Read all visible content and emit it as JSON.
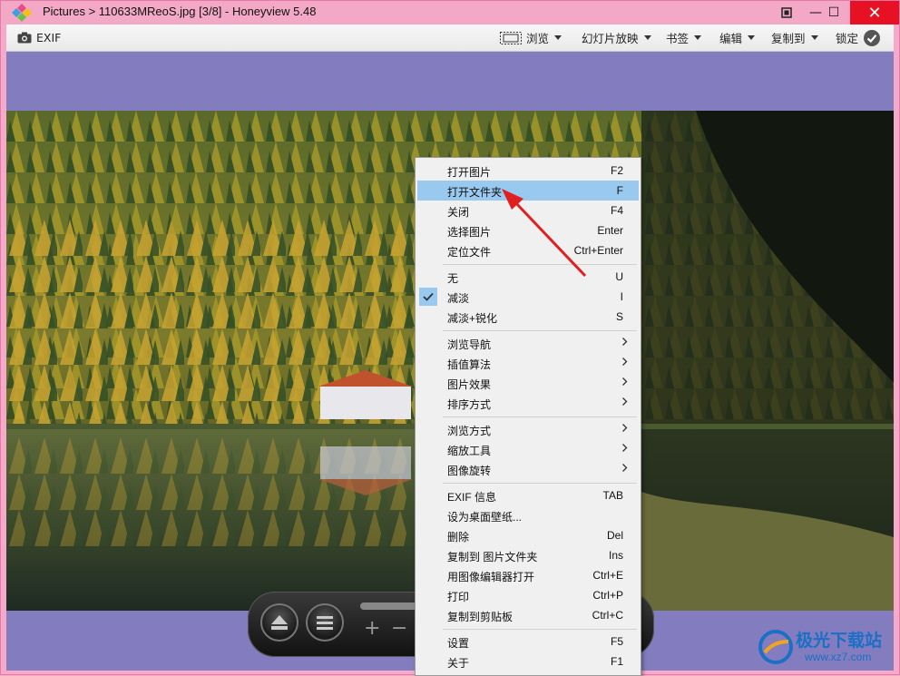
{
  "window": {
    "title": "Pictures > 110633MReoS.jpg [3/8] - Honeyview 5.48",
    "buttons": {
      "minimize": "—",
      "maximize": "☐",
      "close": "✕"
    }
  },
  "toolbar": {
    "exif": "EXIF",
    "browse": "浏览",
    "slideshow": "幻灯片放映",
    "bookmarks": "书签",
    "edit": "编辑",
    "copy_to": "复制到",
    "lock": "锁定"
  },
  "controls": {
    "eject_icon": "eject-icon",
    "menu_icon": "hamburger-icon",
    "zoom_in": "+",
    "zoom_out": "−"
  },
  "context_menu": {
    "hovered": "打开文件夹",
    "checked": "减淡",
    "items": [
      {
        "label": "打开图片",
        "shortcut": "F2"
      },
      {
        "label": "打开文件夹",
        "shortcut": "F"
      },
      {
        "label": "关闭",
        "shortcut": "F4"
      },
      {
        "label": "选择图片",
        "shortcut": "Enter"
      },
      {
        "label": "定位文件",
        "shortcut": "Ctrl+Enter"
      },
      {
        "label": "无",
        "shortcut": "U"
      },
      {
        "label": "减淡",
        "shortcut": "I"
      },
      {
        "label": "减淡+锐化",
        "shortcut": "S"
      },
      {
        "label": "浏览导航",
        "shortcut": ""
      },
      {
        "label": "插值算法",
        "shortcut": ""
      },
      {
        "label": "图片效果",
        "shortcut": ""
      },
      {
        "label": "排序方式",
        "shortcut": ""
      },
      {
        "label": "浏览方式",
        "shortcut": ""
      },
      {
        "label": "缩放工具",
        "shortcut": ""
      },
      {
        "label": "图像旋转",
        "shortcut": ""
      },
      {
        "label": "EXIF 信息",
        "shortcut": "TAB"
      },
      {
        "label": "设为桌面壁纸...",
        "shortcut": ""
      },
      {
        "label": "删除",
        "shortcut": "Del"
      },
      {
        "label": "复制到 图片文件夹",
        "shortcut": "Ins"
      },
      {
        "label": "用图像编辑器打开",
        "shortcut": "Ctrl+E"
      },
      {
        "label": "打印",
        "shortcut": "Ctrl+P"
      },
      {
        "label": "复制到剪贴板",
        "shortcut": "Ctrl+C"
      },
      {
        "label": "设置",
        "shortcut": "F5"
      },
      {
        "label": "关于",
        "shortcut": "F1"
      }
    ]
  },
  "watermark": {
    "title": "极光下载站",
    "url": "www.xz7.com"
  },
  "colors": {
    "titlebar": "#f3a8c6",
    "viewer_bg": "#837dc0",
    "menu_highlight": "#99c9ef",
    "close_button": "#e81123",
    "annotation_arrow": "#e02020"
  }
}
